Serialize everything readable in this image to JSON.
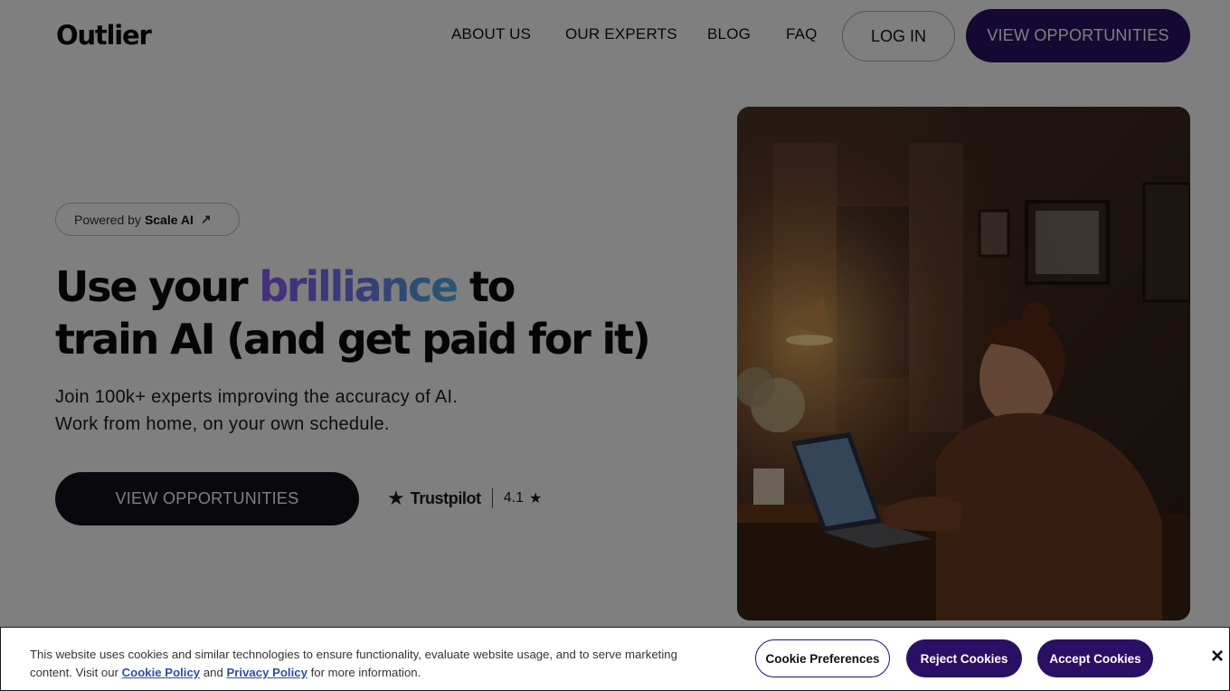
{
  "header": {
    "logo": "Outlier",
    "nav": [
      "ABOUT US",
      "OUR EXPERTS",
      "BLOG",
      "FAQ"
    ],
    "login_label": "LOG IN",
    "cta_label": "VIEW OPPORTUNITIES"
  },
  "hero": {
    "pill_prefix": "Powered by",
    "pill_brand": "Scale AI",
    "pill_arrow": "↗",
    "headline_part1": "Use your ",
    "headline_accent": "brilliance",
    "headline_part2": " to",
    "headline_line2": "train AI (and get paid for it)",
    "sub_line1": "Join 100k+ experts improving the accuracy of AI.",
    "sub_line2": "Work from home, on your own schedule.",
    "cta_label": "VIEW OPPORTUNITIES",
    "trustpilot_name": "Trustpilot",
    "trustpilot_rating": "4.1",
    "star_glyph": "★"
  },
  "photo": {
    "icon": "photo-woman-working-laptop"
  },
  "cookie": {
    "text_main": "This website uses cookies and similar technologies to ensure functionality, evaluate website usage, and to serve marketing content. Visit our ",
    "cookie_policy": "Cookie Policy",
    "and": " and ",
    "privacy_policy": "Privacy Policy",
    "text_end": " for more information.",
    "prefs_label": "Cookie Preferences",
    "reject_label": "Reject Cookies",
    "accept_label": "Accept Cookies",
    "close_glyph": "×"
  },
  "colors": {
    "brand_dark": "#2a1064",
    "accent_gradient_start": "#8a5cf6",
    "accent_gradient_end": "#4fb0e6",
    "overlay": "rgba(0,0,0,0.5)"
  }
}
